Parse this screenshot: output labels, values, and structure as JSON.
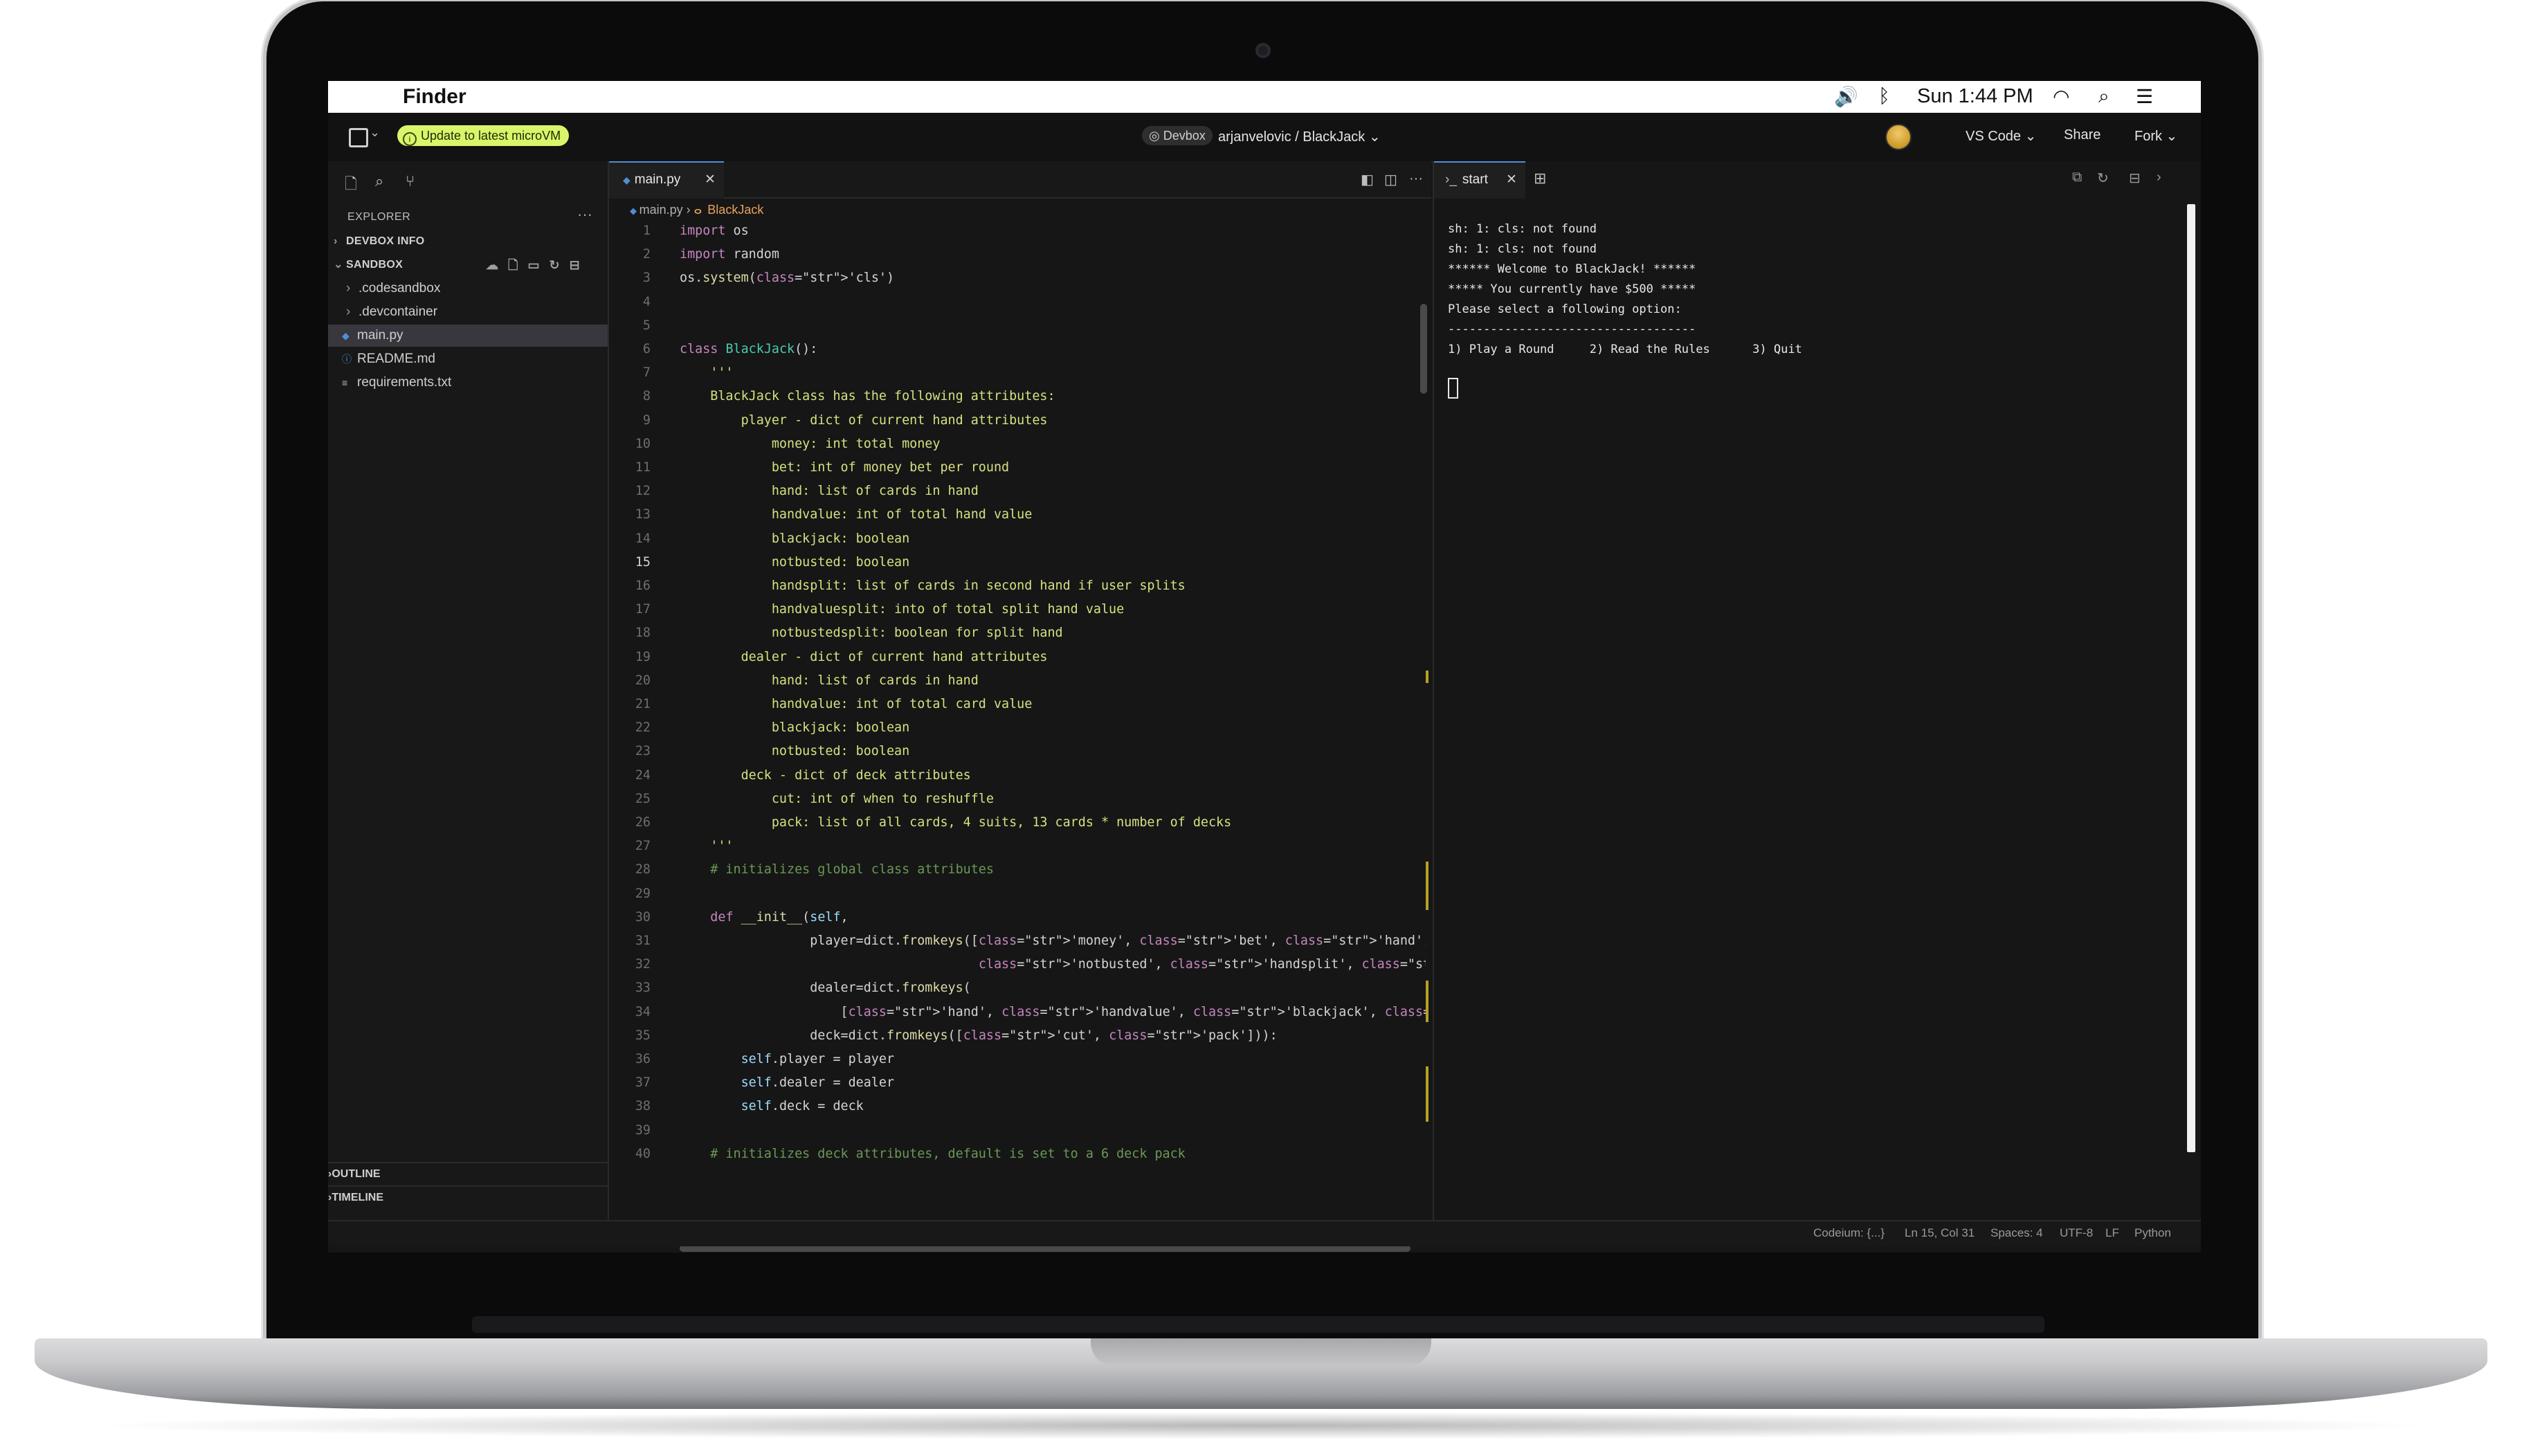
{
  "menubar": {
    "app_name": "Finder",
    "clock": "Sun 1:44 PM"
  },
  "header": {
    "update_badge": "Update to latest microVM",
    "devbox_label": "Devbox",
    "repo_path": "arjanvelovic / BlackJack",
    "vscode_label": "VS Code",
    "share_label": "Share",
    "fork_label": "Fork"
  },
  "sidebar": {
    "title": "EXPLORER",
    "devbox_info": "DEVBOX INFO",
    "sandbox": "SANDBOX",
    "items": [
      {
        "label": ".codesandbox",
        "type": "folder"
      },
      {
        "label": ".devcontainer",
        "type": "folder"
      },
      {
        "label": "main.py",
        "type": "python-file"
      },
      {
        "label": "README.md",
        "type": "info-file"
      },
      {
        "label": "requirements.txt",
        "type": "text-file"
      }
    ],
    "outline": "OUTLINE",
    "timeline": "TIMELINE"
  },
  "editor": {
    "tab_label": "main.py",
    "breadcrumb_file": "main.py",
    "breadcrumb_class": "BlackJack",
    "active_line": 15,
    "lines": [
      {
        "n": "1",
        "text": "import os"
      },
      {
        "n": "2",
        "text": "import random"
      },
      {
        "n": "3",
        "text": "os.system('cls')"
      },
      {
        "n": "4",
        "text": ""
      },
      {
        "n": "5",
        "text": ""
      },
      {
        "n": "6",
        "text": "class BlackJack():"
      },
      {
        "n": "7",
        "text": "    '''"
      },
      {
        "n": "8",
        "text": "    BlackJack class has the following attributes:"
      },
      {
        "n": "9",
        "text": "        player - dict of current hand attributes"
      },
      {
        "n": "10",
        "text": "            money: int total money"
      },
      {
        "n": "11",
        "text": "            bet: int of money bet per round"
      },
      {
        "n": "12",
        "text": "            hand: list of cards in hand"
      },
      {
        "n": "13",
        "text": "            handvalue: int of total hand value"
      },
      {
        "n": "14",
        "text": "            blackjack: boolean"
      },
      {
        "n": "15",
        "text": "            notbusted: boolean"
      },
      {
        "n": "16",
        "text": "            handsplit: list of cards in second hand if user splits"
      },
      {
        "n": "17",
        "text": "            handvaluesplit: into of total split hand value"
      },
      {
        "n": "18",
        "text": "            notbustedsplit: boolean for split hand"
      },
      {
        "n": "19",
        "text": "        dealer - dict of current hand attributes"
      },
      {
        "n": "20",
        "text": "            hand: list of cards in hand"
      },
      {
        "n": "21",
        "text": "            handvalue: int of total card value"
      },
      {
        "n": "22",
        "text": "            blackjack: boolean"
      },
      {
        "n": "23",
        "text": "            notbusted: boolean"
      },
      {
        "n": "24",
        "text": "        deck - dict of deck attributes"
      },
      {
        "n": "25",
        "text": "            cut: int of when to reshuffle"
      },
      {
        "n": "26",
        "text": "            pack: list of all cards, 4 suits, 13 cards * number of decks"
      },
      {
        "n": "27",
        "text": "    '''"
      },
      {
        "n": "28",
        "text": "    # initializes global class attributes"
      },
      {
        "n": "29",
        "text": ""
      },
      {
        "n": "30",
        "text": "    def __init__(self,"
      },
      {
        "n": "31",
        "text": "                 player=dict.fromkeys(['money', 'bet', 'hand', 'handvalue', 'blackjack',"
      },
      {
        "n": "32",
        "text": "                                       'notbusted', 'handsplit', 'handvaluesplit', 'notbustedsplit']),"
      },
      {
        "n": "33",
        "text": "                 dealer=dict.fromkeys("
      },
      {
        "n": "34",
        "text": "                     ['hand', 'handvalue', 'blackjack', 'notbust']),"
      },
      {
        "n": "35",
        "text": "                 deck=dict.fromkeys(['cut', 'pack'])):"
      },
      {
        "n": "36",
        "text": "        self.player = player"
      },
      {
        "n": "37",
        "text": "        self.dealer = dealer"
      },
      {
        "n": "38",
        "text": "        self.deck = deck"
      },
      {
        "n": "39",
        "text": ""
      },
      {
        "n": "40",
        "text": "    # initializes deck attributes, default is set to a 6 deck pack"
      }
    ]
  },
  "terminal": {
    "tab_label": "start",
    "lines": [
      "sh: 1: cls: not found",
      "sh: 1: cls: not found",
      "****** Welcome to BlackJack! ******",
      "***** You currently have $500 *****",
      "Please select a following option:",
      "-----------------------------------"
    ],
    "options": [
      "1) Play a Round",
      "2) Read the Rules",
      "3) Quit"
    ]
  },
  "statusbar": {
    "codeium": "Codeium: {...}",
    "position": "Ln 15, Col 31",
    "spaces": "Spaces: 4",
    "encoding": "UTF-8",
    "eol": "LF",
    "language": "Python"
  },
  "colors": {
    "accent": "#4f8ed6",
    "badge": "#d9f56a",
    "docstring": "#d7e080"
  }
}
